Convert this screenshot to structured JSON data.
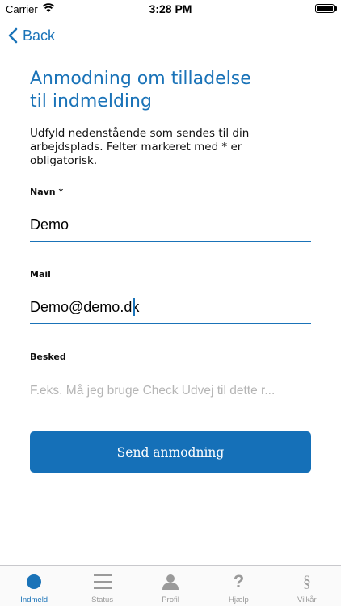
{
  "status_bar": {
    "carrier": "Carrier",
    "time": "3:28 PM"
  },
  "nav": {
    "back_label": "Back"
  },
  "page": {
    "title_line1": "Anmodning om tilladelse",
    "title_line2": "til indmelding",
    "intro_line1": "Udfyld nedenstående som sendes til din",
    "intro_line2": "arbejdsplads. Felter markeret med * er",
    "intro_line3": "obligatorisk."
  },
  "form": {
    "name_label": "Navn *",
    "name_value": "Demo",
    "mail_label": "Mail",
    "mail_value": "Demo@demo.dk",
    "message_label": "Besked",
    "message_placeholder": "F.eks. Må jeg bruge Check Udvej til dette r...",
    "submit_label": "Send anmodning"
  },
  "tabs": [
    {
      "label": "Indmeld",
      "icon": "circle-icon",
      "active": true
    },
    {
      "label": "Status",
      "icon": "list-icon",
      "active": false
    },
    {
      "label": "Profil",
      "icon": "person-icon",
      "active": false
    },
    {
      "label": "Hjælp",
      "icon": "question-icon",
      "active": false
    },
    {
      "label": "Vilkår",
      "icon": "section-icon",
      "active": false
    }
  ],
  "colors": {
    "accent": "#1a73b8",
    "button": "#1570b8",
    "inactive": "#9a9a9a"
  }
}
